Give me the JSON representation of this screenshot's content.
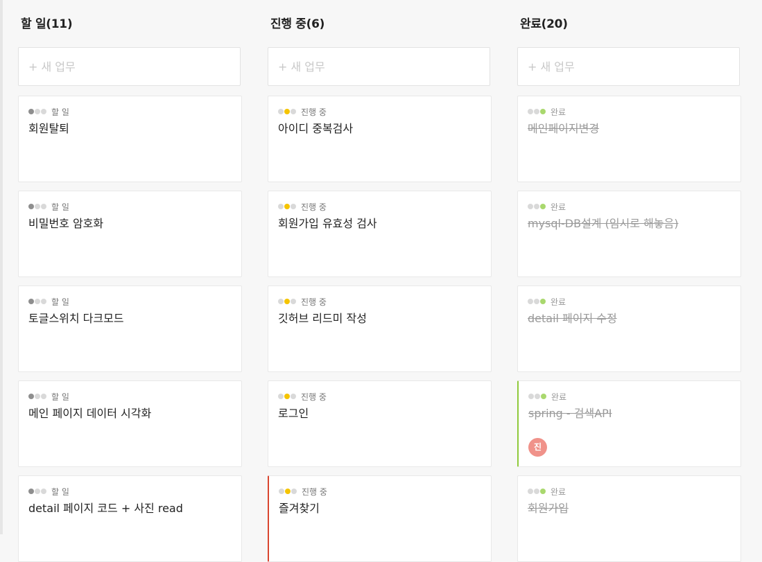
{
  "colors": {
    "todo": "#8e8e8e",
    "in_progress": "#f5c400",
    "done": "#a9d86e",
    "inactive": "#d9d9d9"
  },
  "columns": [
    {
      "title": "할 일(11)",
      "new_placeholder": "+ 새 업무",
      "cards": [
        {
          "status": "할 일",
          "title": "회원탈퇴",
          "active_dot": 0
        },
        {
          "status": "할 일",
          "title": "비밀번호 암호화",
          "active_dot": 0
        },
        {
          "status": "할 일",
          "title": "토글스위치 다크모드",
          "active_dot": 0
        },
        {
          "status": "할 일",
          "title": "메인 페이지 데이터 시각화",
          "active_dot": 0
        },
        {
          "status": "할 일",
          "title": "detail 페이지 코드 + 사진 read",
          "active_dot": 0
        }
      ]
    },
    {
      "title": "진행 중(6)",
      "new_placeholder": "+ 새 업무",
      "cards": [
        {
          "status": "진행 중",
          "title": "아이디 중복검사",
          "active_dot": 1
        },
        {
          "status": "진행 중",
          "title": "회원가입 유효성 검사",
          "active_dot": 1
        },
        {
          "status": "진행 중",
          "title": "깃허브 리드미 작성",
          "active_dot": 1
        },
        {
          "status": "진행 중",
          "title": "로그인",
          "active_dot": 1
        },
        {
          "status": "진행 중",
          "title": "즐겨찾기",
          "active_dot": 1,
          "accent": "red"
        }
      ]
    },
    {
      "title": "완료(20)",
      "new_placeholder": "+ 새 업무",
      "cards": [
        {
          "status": "완료",
          "title": "메인페이지변경",
          "active_dot": 2
        },
        {
          "status": "완료",
          "title": "mysql-DB설계 (임시로 해놓음)",
          "active_dot": 2
        },
        {
          "status": "완료",
          "title": "detail 페이지 수정",
          "active_dot": 2
        },
        {
          "status": "완료",
          "title": "spring - 검색API",
          "active_dot": 2,
          "accent": "green",
          "assignee": "진"
        },
        {
          "status": "완료",
          "title": "회원가입",
          "active_dot": 2
        }
      ]
    }
  ]
}
